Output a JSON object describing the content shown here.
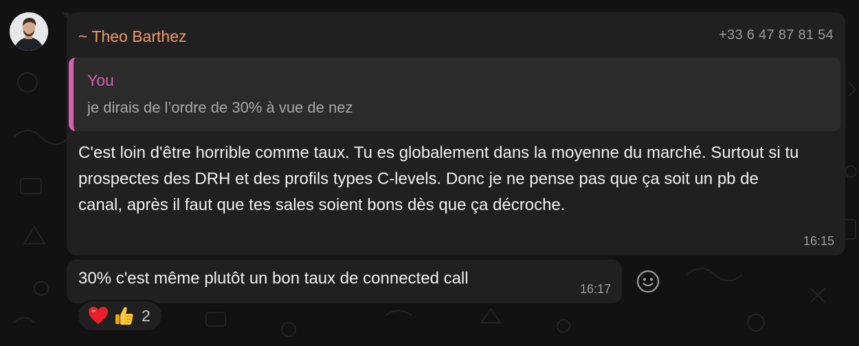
{
  "message": {
    "sender": "~ Theo Barthez",
    "phone": "+33 6 47 87 81 54",
    "quote": {
      "author": "You",
      "text": "je dirais de l’ordre de 30% à vue de nez"
    },
    "text": "C'est loin d'être horrible comme taux. Tu es globalement dans la moyenne du marché. Surtout si tu prospectes des DRH et des profils types C-levels. Donc je ne pense pas que ça soit un pb de canal, après il faut que tes sales soient bons dès que ça décroche.",
    "time": "16:15"
  },
  "second_message": {
    "text": "30% c'est même plutôt un bon taux de connected call",
    "time": "16:17"
  },
  "reactions": {
    "icons": [
      "heart-icon",
      "thumbs-up-icon"
    ],
    "count": "2"
  },
  "colors": {
    "background": "#121212",
    "bubble": "#202020",
    "quote_background": "#2b2b2b",
    "sender_name": "#f19a6a",
    "quote_accent": "#d85fae",
    "timestamp": "#9c9c9c",
    "text": "#f0f0f0"
  }
}
